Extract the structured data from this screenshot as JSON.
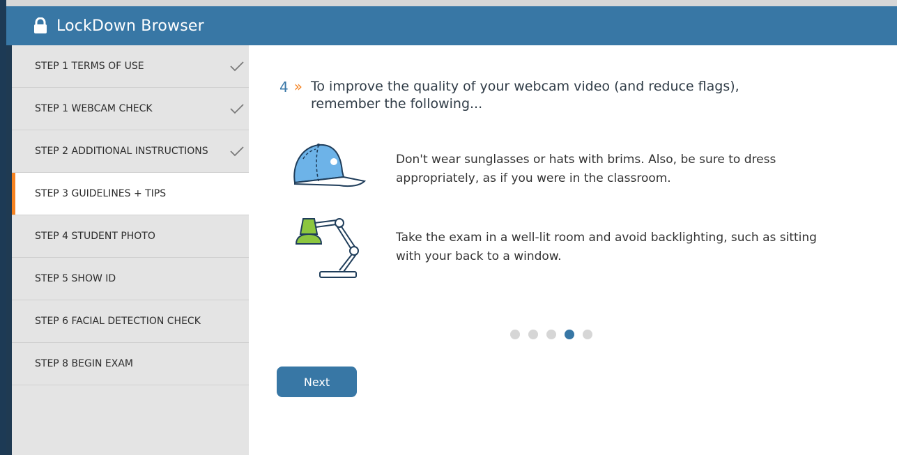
{
  "window": {
    "title": "LockDown Browser",
    "icon": "lock-icon"
  },
  "sidebar": {
    "items": [
      {
        "label": "STEP 1 TERMS OF USE",
        "completed": true
      },
      {
        "label": "STEP 1 WEBCAM CHECK",
        "completed": true
      },
      {
        "label": "STEP 2 ADDITIONAL INSTRUCTIONS",
        "completed": true
      },
      {
        "label": "STEP 3 GUIDELINES + TIPS",
        "active": true
      },
      {
        "label": "STEP 4 STUDENT PHOTO"
      },
      {
        "label": "STEP 5 SHOW ID"
      },
      {
        "label": "STEP 6 FACIAL DETECTION CHECK"
      },
      {
        "label": "STEP 8 BEGIN EXAM"
      }
    ],
    "active_indicator_color": "#f58220"
  },
  "main": {
    "number": "4",
    "chevron": "»",
    "heading": "To improve the quality of your webcam video (and reduce flags), remember the following...",
    "tips": [
      {
        "icon": "cap-icon",
        "text": "Don't wear sunglasses or hats with brims. Also, be sure to dress appropriately, as if you were in the classroom."
      },
      {
        "icon": "desk-lamp-icon",
        "text": "Take the exam in a well-lit room and avoid backlighting, such as sitting with your back to a window."
      }
    ],
    "pagination": {
      "total": 5,
      "current": 4
    },
    "next_label": "Next"
  },
  "colors": {
    "accent": "#3877a5",
    "highlight": "#f58220"
  }
}
